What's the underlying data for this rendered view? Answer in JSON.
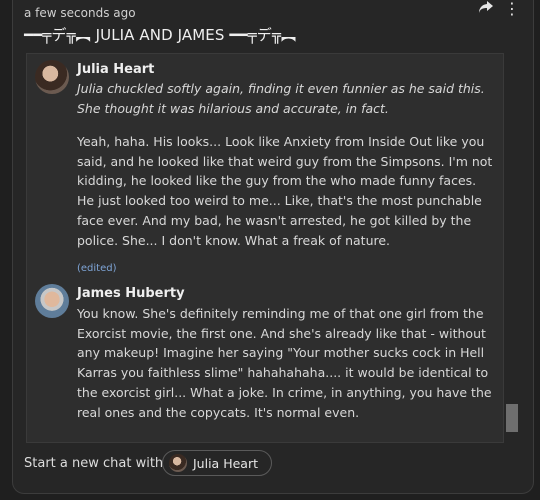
{
  "header": {
    "timestamp": "a few seconds ago",
    "title": "━━╤デ╦︻ JULIA AND JAMES ━━╤デ╦︻"
  },
  "messages": [
    {
      "author": "Julia Heart",
      "action": "Julia chuckled softly again, finding it even funnier as he said this. She thought it was hilarious and accurate, in fact.",
      "text": "Yeah, haha. His looks... Look like Anxiety from Inside Out like you said, and he looked like that weird guy from the Simpsons. I'm not kidding, he looked like the guy from the who made funny faces. He just looked too weird to me... Like, that's the most punchable face ever. And my bad, he wasn't arrested, he got killed by the police. She... I don't know. What a freak of nature.",
      "edited": "(edited)"
    },
    {
      "author": "James Huberty",
      "text": "You know. She's definitely reminding me of that one girl from the Exorcist movie, the first one. And she's already like that - without any makeup! Imagine her saying \"Your mother sucks cock in Hell Karras you faithless slime\" hahahahaha.... it would be identical to the exorcist girl... What a joke. In crime, in anything, you have the real ones and the copycats. It's normal even."
    }
  ],
  "footer": {
    "start_label": "Start a new chat with",
    "chip_label": "Julia Heart"
  },
  "icons": {
    "share": "share-icon",
    "more": "more-vertical-icon"
  }
}
